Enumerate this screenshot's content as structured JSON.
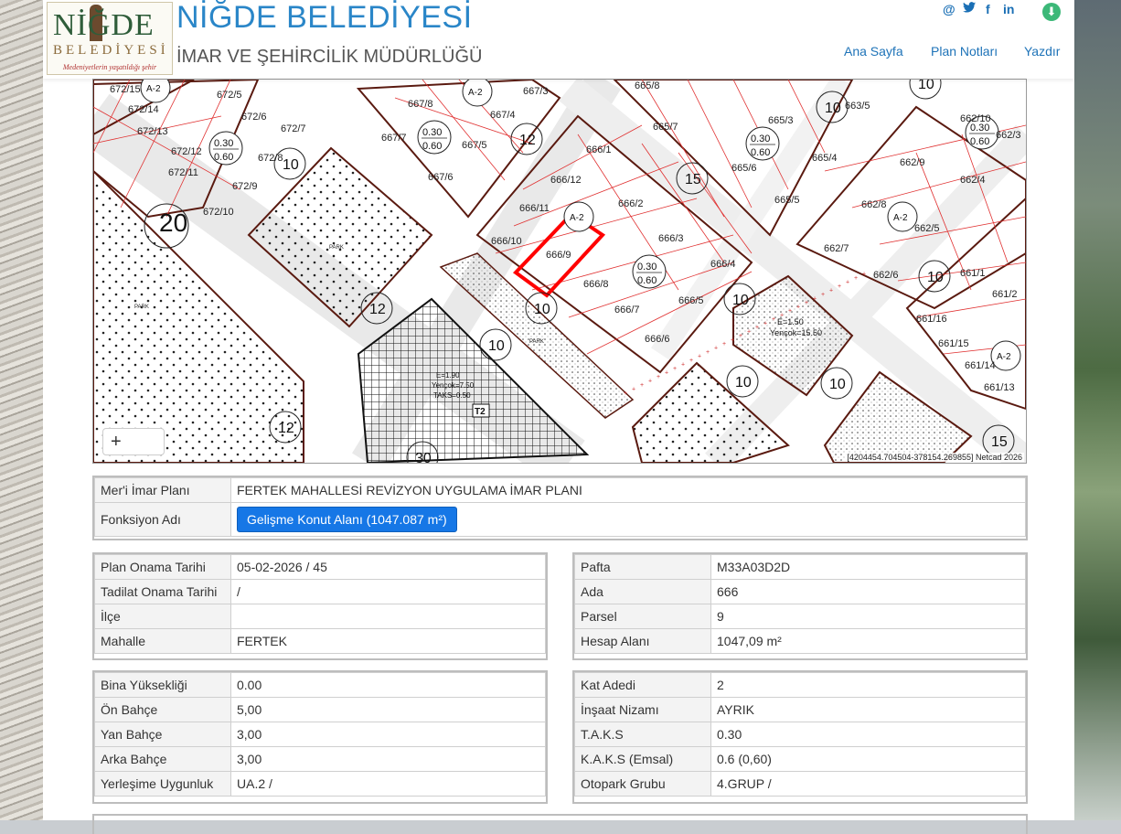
{
  "header": {
    "logo_main": "NİĞDE",
    "logo_sub": "BELEDİYESİ",
    "logo_slogan": "Medeniyetlerin yaşatıldığı şehir",
    "title": "NİĞDE BELEDİYESİ",
    "subtitle": "İMAR VE ŞEHİRCİLİK MÜDÜRLÜĞÜ",
    "social": {
      "email": "@",
      "twitter": "🐦",
      "facebook": "f",
      "linkedin": "in"
    },
    "download_icon": "⬇",
    "nav": [
      "Ana Sayfa",
      "Plan Notları",
      "Yazdır"
    ]
  },
  "map": {
    "zoom_in": "+",
    "coords": "[4204454.704504-378154.269855] Netcad 2026",
    "parcel_labels": [
      "672/15",
      "672/5",
      "672/14",
      "672/6",
      "672/13",
      "672/7",
      "672/12",
      "672/8",
      "672/11",
      "672/9",
      "672/10",
      "667/8",
      "667/4",
      "667/7",
      "667/5",
      "667/6",
      "667/3",
      "666/1",
      "666/12",
      "666/11",
      "666/2",
      "666/10",
      "666/9",
      "666/3",
      "666/8",
      "666/4",
      "666/7",
      "666/5",
      "666/6",
      "665/8",
      "665/7",
      "665/3",
      "665/6",
      "665/5",
      "665/4",
      "663/5",
      "662/10",
      "662/3",
      "662/9",
      "662/4",
      "662/8",
      "662/5",
      "662/7",
      "662/6",
      "661/1",
      "661/2",
      "661/16",
      "661/15",
      "661/14",
      "661/13"
    ],
    "density_labels": [
      "0.30\n0.60"
    ],
    "road_widths": [
      "20",
      "12",
      "12",
      "12",
      "15",
      "10",
      "10",
      "10",
      "10",
      "10",
      "10",
      "10",
      "30"
    ],
    "zone_labels": [
      "A-2\n3",
      "A-2\n3",
      "A-2\n3",
      "A-2\n3"
    ],
    "area_labels": [
      "PARK",
      "PARK",
      "PARK",
      "E=1.50\nYençok=15.50",
      "E=1.50\nYençok=1.10\nTAKS=0.50",
      "T2"
    ]
  },
  "plan": {
    "rows": [
      {
        "k": "Mer'i İmar Planı",
        "v": "FERTEK MAHALLESİ REVİZYON UYGULAMA İMAR PLANI"
      },
      {
        "k": "Fonksiyon Adı",
        "v": "Gelişme Konut Alanı (1047.087 m²)"
      }
    ]
  },
  "left1": [
    {
      "k": "Plan Onama Tarihi",
      "v": "05-02-2026 / 45"
    },
    {
      "k": "Tadilat Onama Tarihi",
      "v": "/"
    },
    {
      "k": "İlçe",
      "v": ""
    },
    {
      "k": "Mahalle",
      "v": "FERTEK"
    }
  ],
  "right1": [
    {
      "k": "Pafta",
      "v": "M33A03D2D"
    },
    {
      "k": "Ada",
      "v": "666"
    },
    {
      "k": "Parsel",
      "v": "9"
    },
    {
      "k": "Hesap Alanı",
      "v": "1047,09 m²"
    }
  ],
  "left2": [
    {
      "k": "Bina Yüksekliği",
      "v": "0.00"
    },
    {
      "k": "Ön Bahçe",
      "v": "5,00"
    },
    {
      "k": "Yan Bahçe",
      "v": "3,00"
    },
    {
      "k": "Arka Bahçe",
      "v": "3,00"
    },
    {
      "k": "Yerleşime Uygunluk",
      "v": "UA.2 /"
    }
  ],
  "right2": [
    {
      "k": "Kat Adedi",
      "v": "2"
    },
    {
      "k": "İnşaat Nizamı",
      "v": "AYRIK"
    },
    {
      "k": "T.A.K.S",
      "v": "0.30"
    },
    {
      "k": "K.A.K.S (Emsal)",
      "v": "0.6 (0,60)"
    },
    {
      "k": "Otopark Grubu",
      "v": "4.GRUP /"
    }
  ]
}
